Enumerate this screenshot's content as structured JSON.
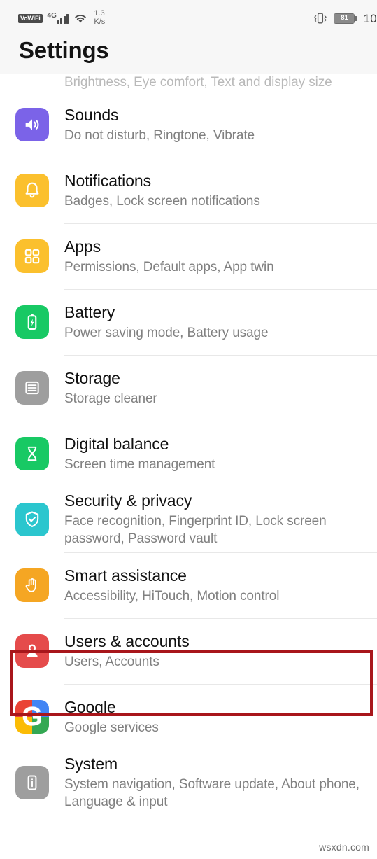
{
  "status_bar": {
    "vowifi_label": "VoWiFi",
    "network_type": "4G",
    "signal_sub": "",
    "net_speed_value": "1.3",
    "net_speed_unit": "K/s",
    "battery_percent": "81",
    "clock": "10"
  },
  "header": {
    "title": "Settings"
  },
  "list": {
    "clipped_top": {
      "subtitle": "Brightness, Eye comfort, Text and display size"
    },
    "items": [
      {
        "title": "Sounds",
        "subtitle": "Do not disturb, Ringtone, Vibrate",
        "icon": "speaker-icon",
        "icon_color": "#7B63E8"
      },
      {
        "title": "Notifications",
        "subtitle": "Badges, Lock screen notifications",
        "icon": "bell-icon",
        "icon_color": "#FBC02D"
      },
      {
        "title": "Apps",
        "subtitle": "Permissions, Default apps, App twin",
        "icon": "grid-icon",
        "icon_color": "#FBC02D"
      },
      {
        "title": "Battery",
        "subtitle": "Power saving mode, Battery usage",
        "icon": "battery-icon",
        "icon_color": "#18C964"
      },
      {
        "title": "Storage",
        "subtitle": "Storage cleaner",
        "icon": "storage-icon",
        "icon_color": "#9E9E9E"
      },
      {
        "title": "Digital balance",
        "subtitle": "Screen time management",
        "icon": "hourglass-icon",
        "icon_color": "#18C964"
      },
      {
        "title": "Security & privacy",
        "subtitle": "Face recognition, Fingerprint ID, Lock screen password, Password vault",
        "icon": "shield-check-icon",
        "icon_color": "#2BC6CE"
      },
      {
        "title": "Smart assistance",
        "subtitle": "Accessibility, HiTouch, Motion control",
        "icon": "hand-icon",
        "icon_color": "#F5A623"
      },
      {
        "title": "Users & accounts",
        "subtitle": "Users, Accounts",
        "icon": "person-icon",
        "icon_color": "#E54B4B"
      },
      {
        "title": "Google",
        "subtitle": "Google services",
        "icon": "google-icon",
        "icon_color": "#EA4335",
        "glyph": "G"
      },
      {
        "title": "System",
        "subtitle": "System navigation, Software update, About phone, Language & input",
        "icon": "phone-info-icon",
        "icon_color": "#9E9E9E"
      }
    ]
  },
  "annotation": {
    "highlight_target": "Users & accounts",
    "highlight_color": "#A8161B"
  },
  "watermark": {
    "text": "wsxdn.com"
  }
}
